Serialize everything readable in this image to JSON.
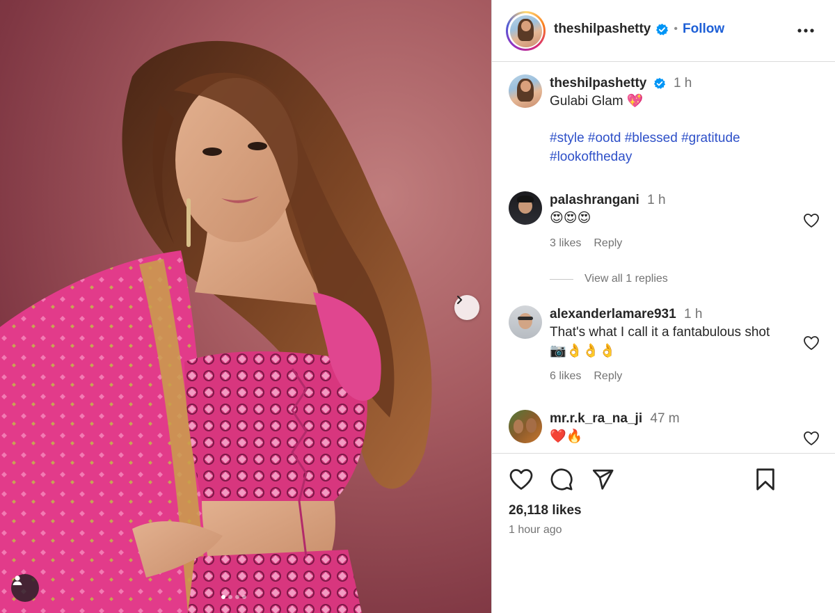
{
  "post": {
    "author": "theshilpashetty",
    "follow_label": "Follow",
    "separator": "•",
    "caption_time": "1 h",
    "caption": "Gulabi Glam 💖",
    "hashtags_line1": "#style #ootd #blessed #gratitude",
    "hashtags_line2": "#lookoftheday",
    "likes": "26,118 likes",
    "posted_ago": "1 hour ago"
  },
  "comments": [
    {
      "user": "palashrangani",
      "time": "1 h",
      "text": "😍😍😍",
      "likes": "3 likes",
      "reply": "Reply"
    },
    {
      "user": "alexanderlamare931",
      "time": "1 h",
      "text": "That's what I call it a fantabulous shot",
      "text2": "📷👌👌👌",
      "likes": "6 likes",
      "reply": "Reply"
    },
    {
      "user": "mr.r.k_ra_na_ji",
      "time": "47 m",
      "text": "❤️🔥"
    }
  ],
  "view_replies": "View all 1 replies",
  "icons": {
    "verified": "verified-badge-icon",
    "more": "more-options-icon",
    "next": "chevron-right-icon",
    "tag": "user-tag-icon",
    "like": "heart-icon",
    "comment": "comment-icon",
    "share": "send-icon",
    "save": "bookmark-icon"
  },
  "colors": {
    "link_blue": "#1d5fd6",
    "hashtag_blue": "#2e50c8",
    "verified_blue": "#0095f6",
    "muted": "#737373",
    "border": "#dbdbdb"
  }
}
